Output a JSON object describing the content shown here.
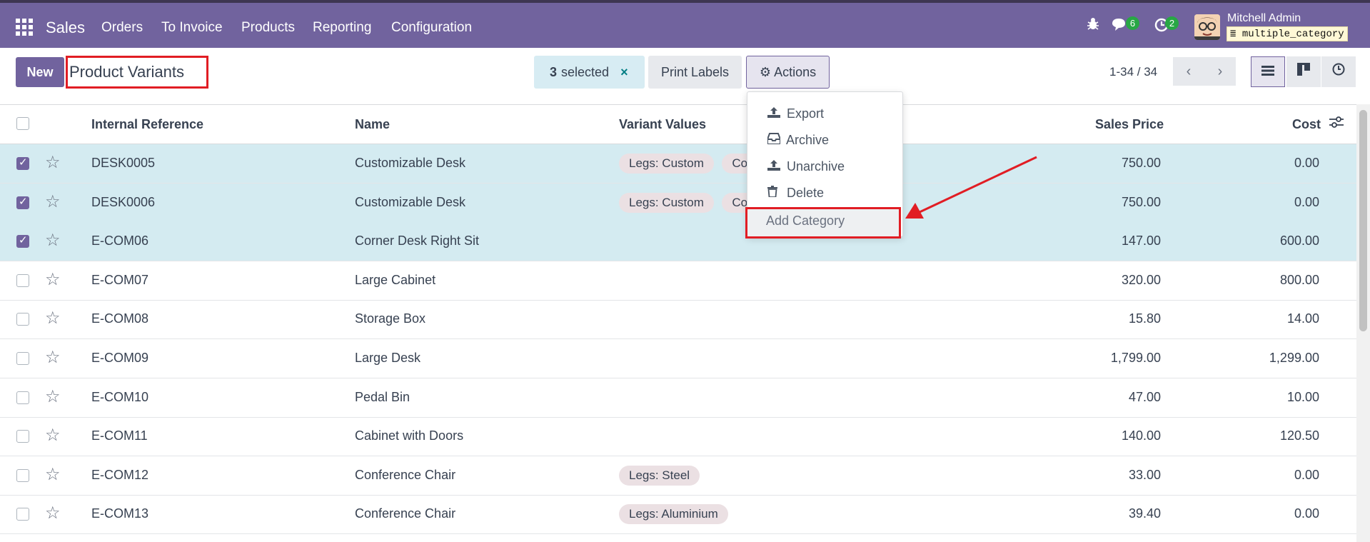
{
  "nav": {
    "brand": "Sales",
    "items": [
      "Orders",
      "To Invoice",
      "Products",
      "Reporting",
      "Configuration"
    ],
    "messages_count": "6",
    "activities_count": "2",
    "user_name": "Mitchell Admin",
    "db_name": "multiple_category"
  },
  "control": {
    "new_label": "New",
    "title": "Product Variants",
    "selected_count": "3",
    "selected_label": "selected",
    "clear_icon": "×",
    "print_label": "Print Labels",
    "actions_label": "Actions",
    "pager": "1-34 / 34"
  },
  "actions_menu": {
    "export": "Export",
    "archive": "Archive",
    "unarchive": "Unarchive",
    "delete": "Delete",
    "add_category": "Add Category"
  },
  "table": {
    "headers": {
      "ref": "Internal Reference",
      "name": "Name",
      "variants": "Variant Values",
      "price": "Sales Price",
      "cost": "Cost"
    },
    "rows": [
      {
        "selected": true,
        "ref": "DESK0005",
        "name": "Customizable Desk",
        "tags": [
          "Legs: Custom",
          "Co"
        ],
        "price": "750.00",
        "cost": "0.00"
      },
      {
        "selected": true,
        "ref": "DESK0006",
        "name": "Customizable Desk",
        "tags": [
          "Legs: Custom",
          "Co"
        ],
        "price": "750.00",
        "cost": "0.00"
      },
      {
        "selected": true,
        "ref": "E-COM06",
        "name": "Corner Desk Right Sit",
        "tags": [],
        "price": "147.00",
        "cost": "600.00"
      },
      {
        "selected": false,
        "ref": "E-COM07",
        "name": "Large Cabinet",
        "tags": [],
        "price": "320.00",
        "cost": "800.00"
      },
      {
        "selected": false,
        "ref": "E-COM08",
        "name": "Storage Box",
        "tags": [],
        "price": "15.80",
        "cost": "14.00"
      },
      {
        "selected": false,
        "ref": "E-COM09",
        "name": "Large Desk",
        "tags": [],
        "price": "1,799.00",
        "cost": "1,299.00"
      },
      {
        "selected": false,
        "ref": "E-COM10",
        "name": "Pedal Bin",
        "tags": [],
        "price": "47.00",
        "cost": "10.00"
      },
      {
        "selected": false,
        "ref": "E-COM11",
        "name": "Cabinet with Doors",
        "tags": [],
        "price": "140.00",
        "cost": "120.50"
      },
      {
        "selected": false,
        "ref": "E-COM12",
        "name": "Conference Chair",
        "tags": [
          "Legs: Steel"
        ],
        "price": "33.00",
        "cost": "0.00"
      },
      {
        "selected": false,
        "ref": "E-COM13",
        "name": "Conference Chair",
        "tags": [
          "Legs: Aluminium"
        ],
        "price": "39.40",
        "cost": "0.00"
      }
    ]
  },
  "colors": {
    "brand": "#71639e",
    "selected_row": "#d4ebf1",
    "highlight_red": "#e11d24"
  }
}
